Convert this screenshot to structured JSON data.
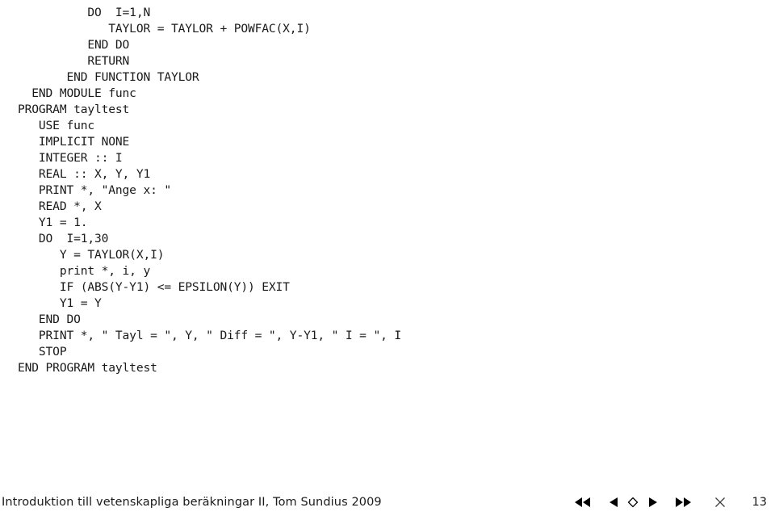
{
  "slide": {
    "background_color": "#ffffff",
    "text_color": "#1a1a1a"
  },
  "code": {
    "language": "Fortran",
    "lines": [
      "          DO  I=1,N",
      "             TAYLOR = TAYLOR + POWFAC(X,I)",
      "          END DO",
      "          RETURN",
      "       END FUNCTION TAYLOR",
      "  END MODULE func",
      "PROGRAM tayltest",
      "   USE func",
      "   IMPLICIT NONE",
      "   INTEGER :: I",
      "   REAL :: X, Y, Y1",
      "   PRINT *, \"Ange x: \"",
      "   READ *, X",
      "   Y1 = 1.",
      "   DO  I=1,30",
      "      Y = TAYLOR(X,I)",
      "      print *, i, y",
      "      IF (ABS(Y-Y1) <= EPSILON(Y)) EXIT",
      "      Y1 = Y",
      "   END DO",
      "   PRINT *, \" Tayl = \", Y, \" Diff = \", Y-Y1, \" I = \", I",
      "   STOP",
      "END PROGRAM tayltest"
    ]
  },
  "footer": {
    "title": "Introduktion till vetenskapliga beräkningar II, Tom Sundius 2009",
    "page_number": "13",
    "nav": [
      {
        "name": "first-slide-icon",
        "label": "First slide"
      },
      {
        "name": "previous-slide-icon",
        "label": "Previous slide"
      },
      {
        "name": "current-slide-icon",
        "label": "Current slide"
      },
      {
        "name": "next-slide-icon",
        "label": "Next slide"
      },
      {
        "name": "last-slide-icon",
        "label": "Last slide"
      },
      {
        "name": "close-icon",
        "label": "End presentation"
      }
    ]
  }
}
